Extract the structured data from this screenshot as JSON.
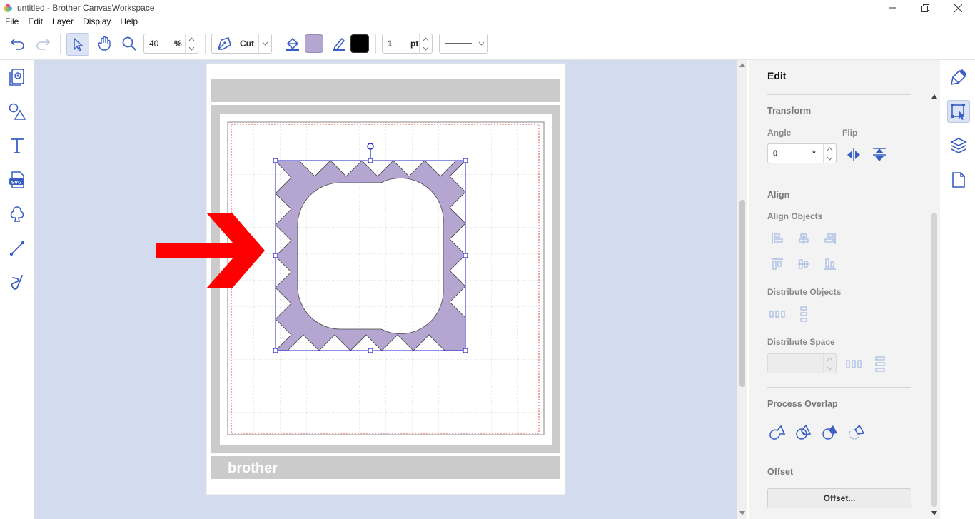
{
  "window": {
    "title": "untitled - Brother CanvasWorkspace",
    "controls": [
      "minimize-icon",
      "restore-icon",
      "close-icon"
    ]
  },
  "menu": [
    "File",
    "Edit",
    "Layer",
    "Display",
    "Help"
  ],
  "toolbar": {
    "zoom_value": "40",
    "zoom_unit": "%",
    "mode_label": "Cut",
    "fill_color": "#b4a6d1",
    "line_color": "#000000",
    "line_width_value": "1",
    "line_width_unit": "pt"
  },
  "left_tools": [
    "pattern-library-icon",
    "shapes-icon",
    "text-icon",
    "svg-import-icon",
    "cloud-shape-icon",
    "line-tool-icon",
    "freehand-tool-icon"
  ],
  "canvas": {
    "mat_brand": "brother",
    "selection_fill": "#b4a6d1",
    "selection_stroke": "#2323c8",
    "arrow_color": "#ff0000"
  },
  "panel": {
    "title": "Edit",
    "transform": {
      "heading": "Transform",
      "angle_label": "Angle",
      "angle_value": "0",
      "angle_unit": "°",
      "flip_label": "Flip"
    },
    "align": {
      "heading": "Align",
      "align_objects_label": "Align Objects",
      "distribute_objects_label": "Distribute Objects",
      "distribute_space_label": "Distribute Space"
    },
    "process_overlap": {
      "heading": "Process Overlap"
    },
    "offset": {
      "heading": "Offset",
      "button_label": "Offset..."
    }
  },
  "right_tools": [
    "paint-brush-icon",
    "edit-select-icon",
    "layers-icon",
    "page-icon"
  ]
}
